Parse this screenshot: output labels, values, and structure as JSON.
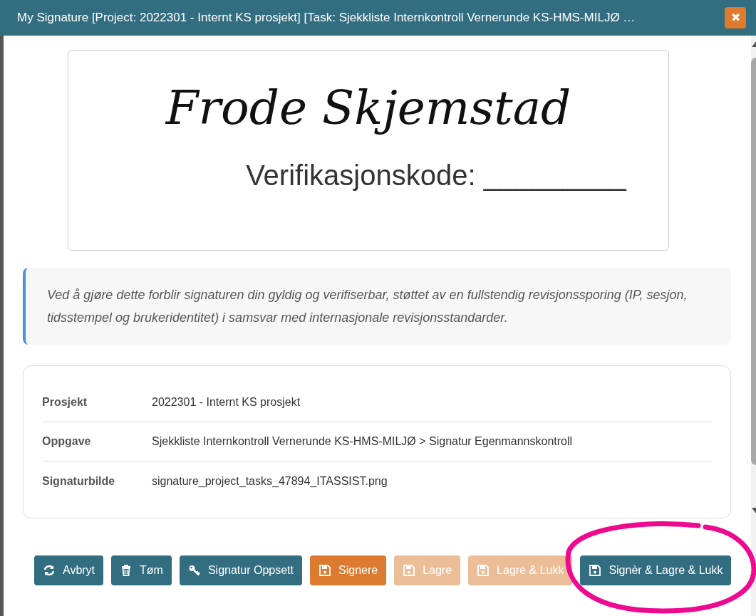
{
  "window": {
    "title": "My Signature [Project: 2022301 - Internt KS prosjekt] [Task: Sjekkliste Internkontroll Vernerunde KS-HMS-MILJØ …",
    "close": "✖"
  },
  "signature_image": {
    "name": "Frode Skjemstad",
    "verification_label": "Verifikasjonskode: _________"
  },
  "notice": "Ved å gjøre dette forblir signaturen din gyldig og verifiserbar, støttet av en fullstendig revisjonssporing (IP, sesjon, tidsstempel og brukeridentitet) i samsvar med internasjonale revisjonsstandarder.",
  "details": [
    {
      "label": "Prosjekt",
      "value": "2022301 - Internt KS prosjekt"
    },
    {
      "label": "Oppgave",
      "value": "Sjekkliste Internkontroll Vernerunde KS-HMS-MILJØ > Signatur Egenmannskontroll"
    },
    {
      "label": "Signaturbilde",
      "value": "signature_project_tasks_47894_ITASSIST.png"
    }
  ],
  "buttons": [
    {
      "label": "Avbryt",
      "kind": "teal",
      "disabled": false
    },
    {
      "label": "Tøm",
      "kind": "teal",
      "disabled": false
    },
    {
      "label": "Signatur Oppsett",
      "kind": "teal",
      "disabled": false
    },
    {
      "label": "Signere",
      "kind": "orange",
      "disabled": false
    },
    {
      "label": "Lagre",
      "kind": "orange",
      "disabled": true
    },
    {
      "label": "Lagre & Lukk",
      "kind": "orange",
      "disabled": true
    },
    {
      "label": "Signèr & Lagre & Lukk",
      "kind": "teal",
      "disabled": false
    }
  ],
  "annotation": {
    "kind": "circle",
    "color": "#ee0a8f"
  }
}
